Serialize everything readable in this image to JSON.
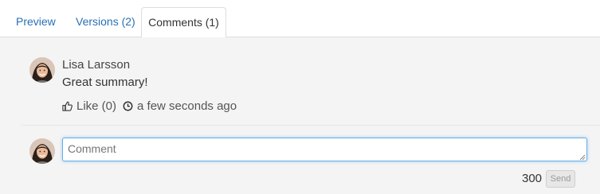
{
  "tabs": [
    {
      "label": "Preview",
      "active": false
    },
    {
      "label": "Versions (2)",
      "active": false
    },
    {
      "label": "Comments (1)",
      "active": true
    }
  ],
  "comment": {
    "author": "Lisa Larsson",
    "text": "Great summary!",
    "like_label": "Like (0)",
    "time": "a few seconds ago"
  },
  "composer": {
    "placeholder": "Comment",
    "char_count": "300",
    "send_label": "Send"
  },
  "colors": {
    "link": "#2a6fb5",
    "panel_bg": "#f4f4f4",
    "input_focus": "#66afe9"
  },
  "icons": {
    "like": "thumbs-up-icon",
    "time": "clock-icon"
  }
}
